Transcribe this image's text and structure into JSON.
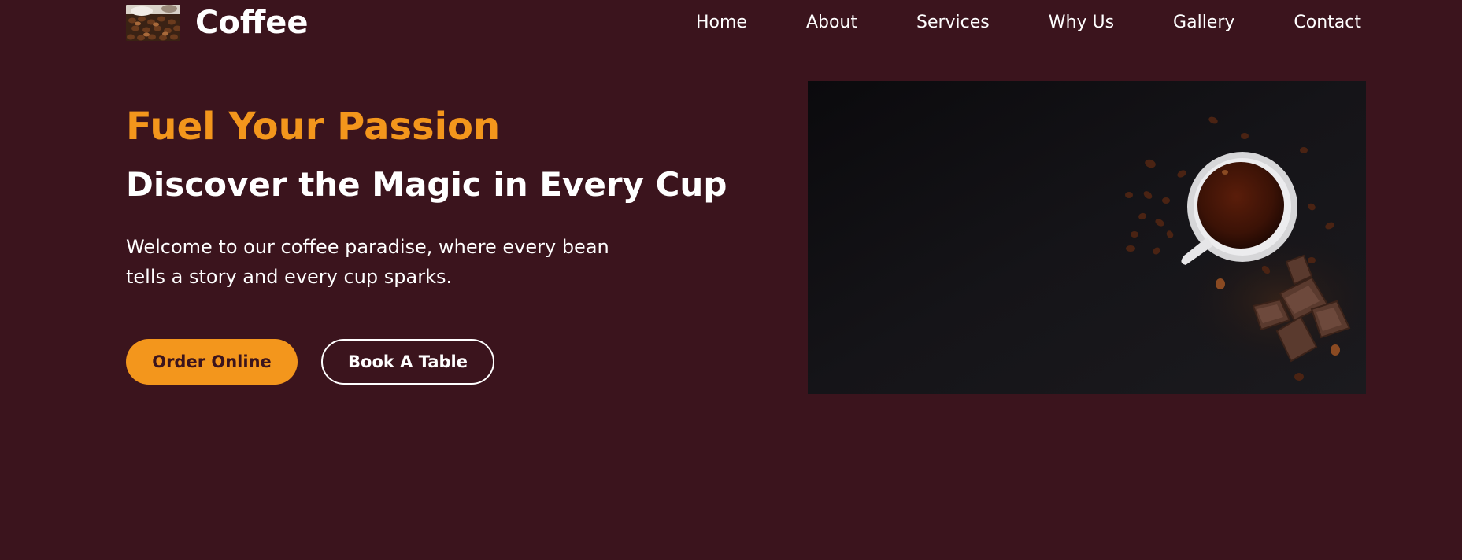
{
  "header": {
    "brand_name": "Coffee",
    "logo_icon": "coffee-beans-logo",
    "nav": [
      {
        "label": "Home"
      },
      {
        "label": "About"
      },
      {
        "label": "Services"
      },
      {
        "label": "Why Us"
      },
      {
        "label": "Gallery"
      },
      {
        "label": "Contact"
      }
    ]
  },
  "hero": {
    "tagline": "Fuel Your Passion",
    "title": "Discover the Magic in Every Cup",
    "description": "Welcome to our coffee paradise, where every bean tells a story and every cup sparks.",
    "buttons": {
      "primary": "Order Online",
      "secondary": "Book A Table"
    },
    "image_icon": "coffee-cup-hero-image"
  },
  "colors": {
    "background": "#3b141d",
    "accent": "#f3961c",
    "text": "#ffffff"
  }
}
